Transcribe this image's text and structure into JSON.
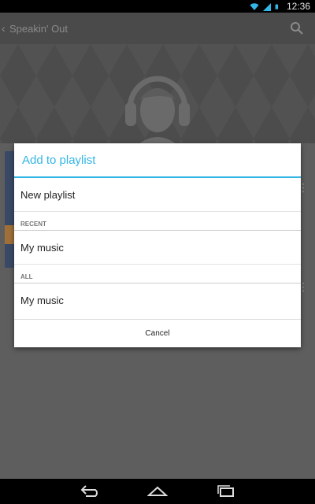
{
  "status_bar": {
    "time": "12:36",
    "icons": [
      "wifi-icon",
      "signal-icon",
      "battery-icon"
    ]
  },
  "action_bar": {
    "title": "Speakin' Out",
    "back_icon": "chevron-left-icon",
    "search_icon": "search-icon"
  },
  "hero": {
    "avatar_icon": "headphones-avatar-icon"
  },
  "dialog": {
    "title": "Add to playlist",
    "new_playlist": "New playlist",
    "sections": [
      {
        "label": "RECENT",
        "items": [
          "My music"
        ]
      },
      {
        "label": "ALL",
        "items": [
          "My music"
        ]
      }
    ],
    "cancel": "Cancel"
  },
  "nav_bar": {
    "icons": [
      "back-nav-icon",
      "home-nav-icon",
      "recents-nav-icon"
    ]
  },
  "colors": {
    "accent": "#33b5e5",
    "status_bar": "#000000"
  }
}
